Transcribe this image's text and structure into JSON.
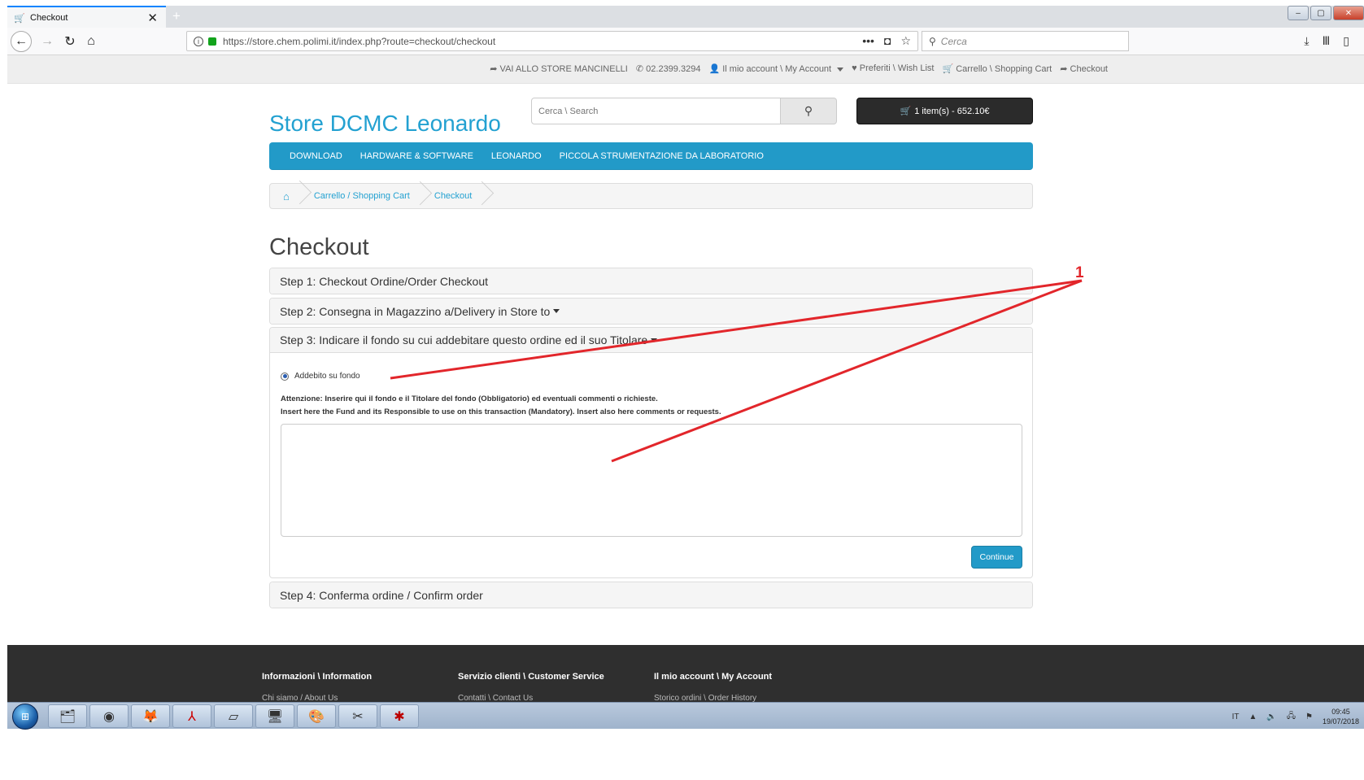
{
  "browser": {
    "tab_title": "Checkout",
    "url": "https://store.chem.polimi.it/index.php?route=checkout/checkout",
    "search_placeholder": "Cerca"
  },
  "topbar": {
    "items": [
      "VAI ALLO STORE MANCINELLI",
      "02.2399.3294",
      "Il mio account \\ My Account",
      "Preferiti \\ Wish List",
      "Carrello \\ Shopping Cart",
      "Checkout"
    ]
  },
  "header": {
    "logo": "Store DCMC Leonardo",
    "search_placeholder": "Cerca \\ Search",
    "cart_label": "1 item(s) - 652.10€"
  },
  "menu": {
    "items": [
      "DOWNLOAD",
      "HARDWARE & SOFTWARE",
      "LEONARDO",
      "PICCOLA STRUMENTAZIONE DA LABORATORIO"
    ]
  },
  "breadcrumb": {
    "items": [
      "Carrello / Shopping Cart",
      "Checkout"
    ]
  },
  "checkout": {
    "title": "Checkout",
    "step1": "Step 1: Checkout Ordine/Order Checkout",
    "step2": "Step 2: Consegna in Magazzino a/Delivery in Store to",
    "step3": "Step 3: Indicare il fondo su cui addebitare questo ordine ed il suo Titolare",
    "step4": "Step 4: Conferma ordine / Confirm order",
    "radio_label": "Addebito su fondo",
    "notice_line1": "Attenzione: Inserire qui il fondo e il Titolare del fondo (Obbligatorio) ed eventuali commenti o richieste.",
    "notice_line2": "Insert here the Fund and its Responsible to use on this transaction (Mandatory). Insert also here comments or requests.",
    "continue_label": "Continue"
  },
  "footer": {
    "col1_title": "Informazioni \\ Information",
    "col1_link": "Chi siamo / About Us",
    "col2_title": "Servizio clienti \\ Customer Service",
    "col2_link": "Contatti \\ Contact Us",
    "col3_title": "Il mio account \\ My Account",
    "col3_link": "Storico ordini \\ Order History"
  },
  "taskbar": {
    "lang": "IT",
    "time": "09:45",
    "date": "19/07/2018"
  },
  "annotation": {
    "label": "1",
    "color": "#e2262b"
  }
}
